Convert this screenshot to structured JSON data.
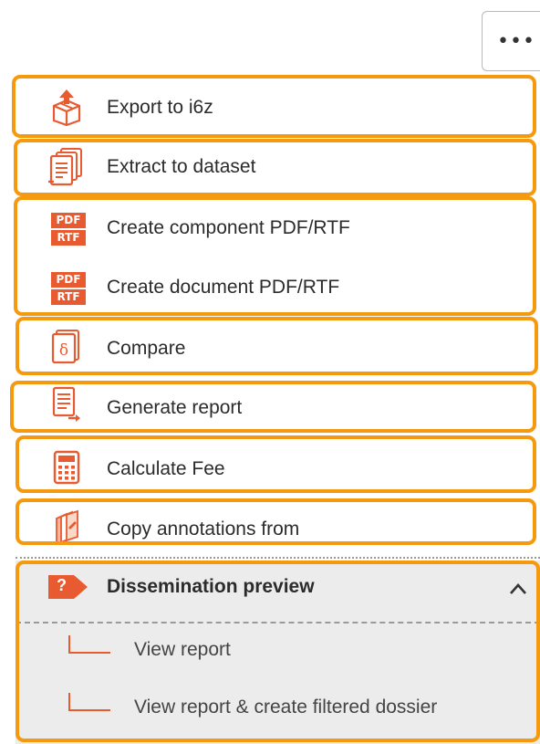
{
  "toolbar": {
    "more_label": "•••"
  },
  "menu": {
    "items": [
      {
        "label": "Export to i6z",
        "icon": "export-box-icon"
      },
      {
        "label": "Extract to dataset",
        "icon": "extract-documents-icon"
      },
      {
        "label": "Create component PDF/RTF",
        "icon": "pdf-rtf-icon"
      },
      {
        "label": "Create document PDF/RTF",
        "icon": "pdf-rtf-icon"
      },
      {
        "label": "Compare",
        "icon": "compare-icon"
      },
      {
        "label": "Generate report",
        "icon": "report-icon"
      },
      {
        "label": "Calculate Fee",
        "icon": "calculator-icon"
      },
      {
        "label": "Copy annotations from",
        "icon": "annotations-icon"
      }
    ],
    "pdf_badge": {
      "top": "PDF",
      "bottom": "RTF"
    }
  },
  "dissemination": {
    "label": "Dissemination preview",
    "icon_text": "?",
    "expanded": true,
    "sub_items": [
      {
        "label": "View report"
      },
      {
        "label": "View report & create filtered dossier"
      }
    ]
  },
  "colors": {
    "accent": "#e85a2f",
    "highlight": "#f59a0f",
    "section_bg": "#ececec"
  }
}
